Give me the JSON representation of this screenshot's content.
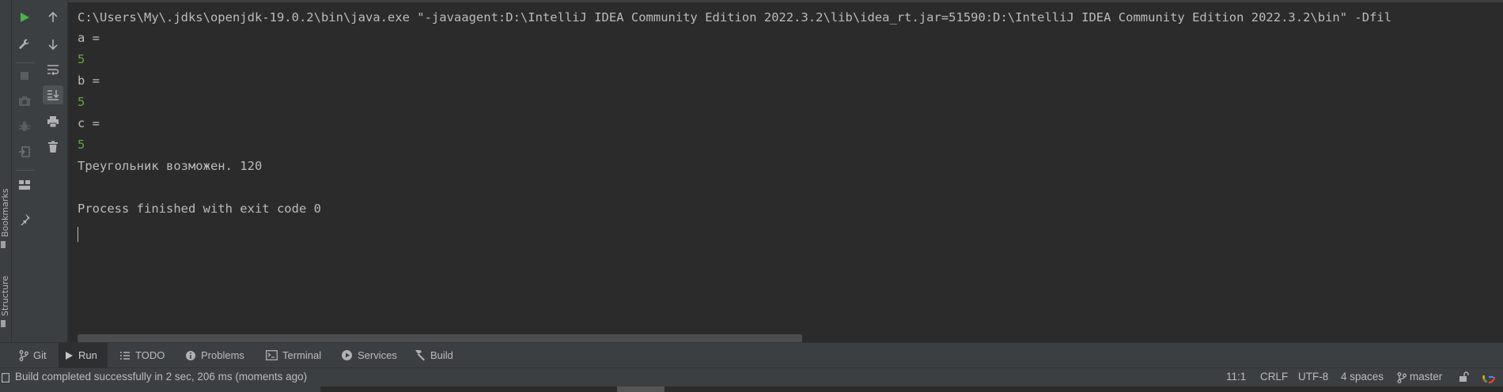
{
  "sidebar": {
    "bookmarks_label": "Bookmarks",
    "structure_label": "Structure"
  },
  "console": {
    "lines": [
      {
        "text": "C:\\Users\\My\\.jdks\\openjdk-19.0.2\\bin\\java.exe \"-javaagent:D:\\IntelliJ IDEA Community Edition 2022.3.2\\lib\\idea_rt.jar=51590:D:\\IntelliJ IDEA Community Edition 2022.3.2\\bin\" -Dfil",
        "kind": "output"
      },
      {
        "text": "a =",
        "kind": "output"
      },
      {
        "text": "5",
        "kind": "input"
      },
      {
        "text": "b =",
        "kind": "output"
      },
      {
        "text": "5",
        "kind": "input"
      },
      {
        "text": "c =",
        "kind": "output"
      },
      {
        "text": "5",
        "kind": "input"
      },
      {
        "text": "Треугольник возможен. 120",
        "kind": "output"
      },
      {
        "text": "",
        "kind": "output"
      },
      {
        "text": "Process finished with exit code 0",
        "kind": "output"
      }
    ]
  },
  "tool_tabs": [
    {
      "label": "Git",
      "icon": "git-branch-icon"
    },
    {
      "label": "Run",
      "icon": "run-triangle-icon",
      "active": true
    },
    {
      "label": "TODO",
      "icon": "todo-list-icon"
    },
    {
      "label": "Problems",
      "icon": "problems-info-icon"
    },
    {
      "label": "Terminal",
      "icon": "terminal-icon"
    },
    {
      "label": "Services",
      "icon": "services-icon"
    },
    {
      "label": "Build",
      "icon": "build-hammer-icon"
    }
  ],
  "status": {
    "message": "Build completed successfully in 2 sec, 206 ms (moments ago)",
    "position": "11:1",
    "line_separator": "CRLF",
    "encoding": "UTF-8",
    "indent": "4 spaces",
    "branch": "master"
  },
  "colors": {
    "background": "#2b2b2b",
    "panel": "#3c3f41",
    "console_text": "#bbbbbb",
    "user_input": "#62a348",
    "run_green": "#4fb04f"
  }
}
